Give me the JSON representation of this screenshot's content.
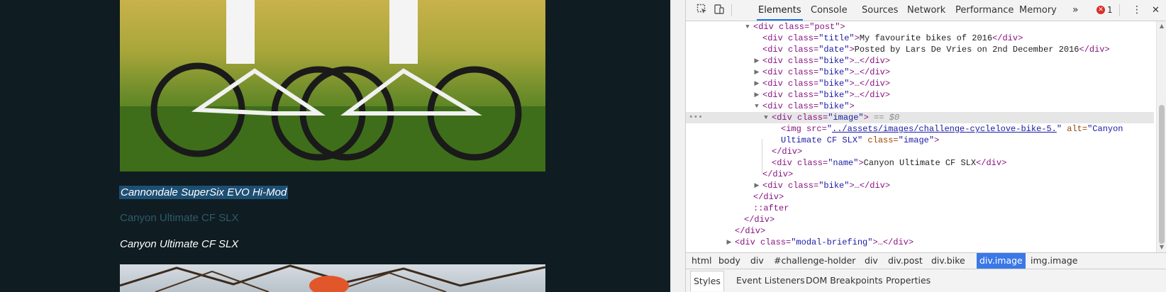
{
  "page": {
    "bike_names": [
      "Cannondale SuperSix EVO Hi-Mod",
      "Canyon Ultimate CF SLX",
      "Canyon Ultimate CF SLX"
    ]
  },
  "devtools": {
    "tabs": [
      "Elements",
      "Console",
      "Sources",
      "Network",
      "Performance",
      "Memory"
    ],
    "more_tabs": "»",
    "error_count": "1",
    "error_icon_glyph": "✕",
    "menu_glyph": "⋮",
    "close_glyph": "✕",
    "tree": {
      "post_open": "<div class=\"post\">",
      "title_line": [
        "<div class=",
        "\"title\"",
        ">",
        "My favourite bikes of 2016",
        "</div>"
      ],
      "date_line": [
        "<div class=",
        "\"date\"",
        ">",
        "Posted by Lars De Vries on 2nd December 2016",
        "</div>"
      ],
      "bike_collapsed": [
        "<div class=",
        "\"bike\"",
        ">…</div>"
      ],
      "bike_open": [
        "<div class=",
        "\"bike\"",
        ">"
      ],
      "image_open": [
        "<div class=",
        "\"image\"",
        ">",
        "== $0"
      ],
      "img_tag_start": "<img src=",
      "img_src": "../assets/images/challenge-cyclelove-bike-5.",
      "img_alt_attr": " alt=",
      "img_alt_val1": "\"Canyon",
      "img_alt_val2": "Ultimate CF SLX\"",
      "img_class_attr": " class=",
      "img_class_val": "\"image\"",
      "img_close": ">",
      "div_close": "</div>",
      "name_line": [
        "<div class=",
        "\"name\"",
        ">",
        "Canyon Ultimate CF SLX",
        "</div>"
      ],
      "after": "::after",
      "modal_line": [
        "<div class=",
        "\"modal-briefing\"",
        ">…</div>"
      ],
      "dots": "•••"
    },
    "breadcrumbs": [
      "html",
      "body",
      "div",
      "#challenge-holder",
      "div",
      "div.post",
      "div.bike",
      "div.image",
      "img.image"
    ],
    "breadcrumb_active": "div.image",
    "subtabs": [
      "Styles",
      "Event Listeners",
      "DOM Breakpoints",
      "Properties"
    ],
    "subtab_active": "Styles"
  }
}
